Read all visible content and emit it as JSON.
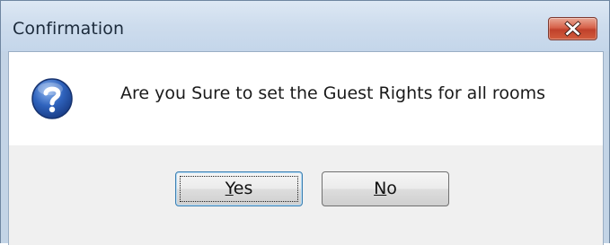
{
  "dialog": {
    "title": "Confirmation",
    "message": "Are you Sure to set the Guest Rights for all rooms",
    "icon": "question-icon",
    "buttons": {
      "yes": {
        "mnemonic": "Y",
        "rest": "es"
      },
      "no": {
        "mnemonic": "N",
        "rest": "o"
      }
    },
    "close_icon": "close-icon"
  },
  "colors": {
    "titlebar": "#cddced",
    "close_button": "#c7452c",
    "question_icon": "#2a5db0",
    "button_face": "#e6e6e6",
    "footer": "#f0f0f0"
  }
}
